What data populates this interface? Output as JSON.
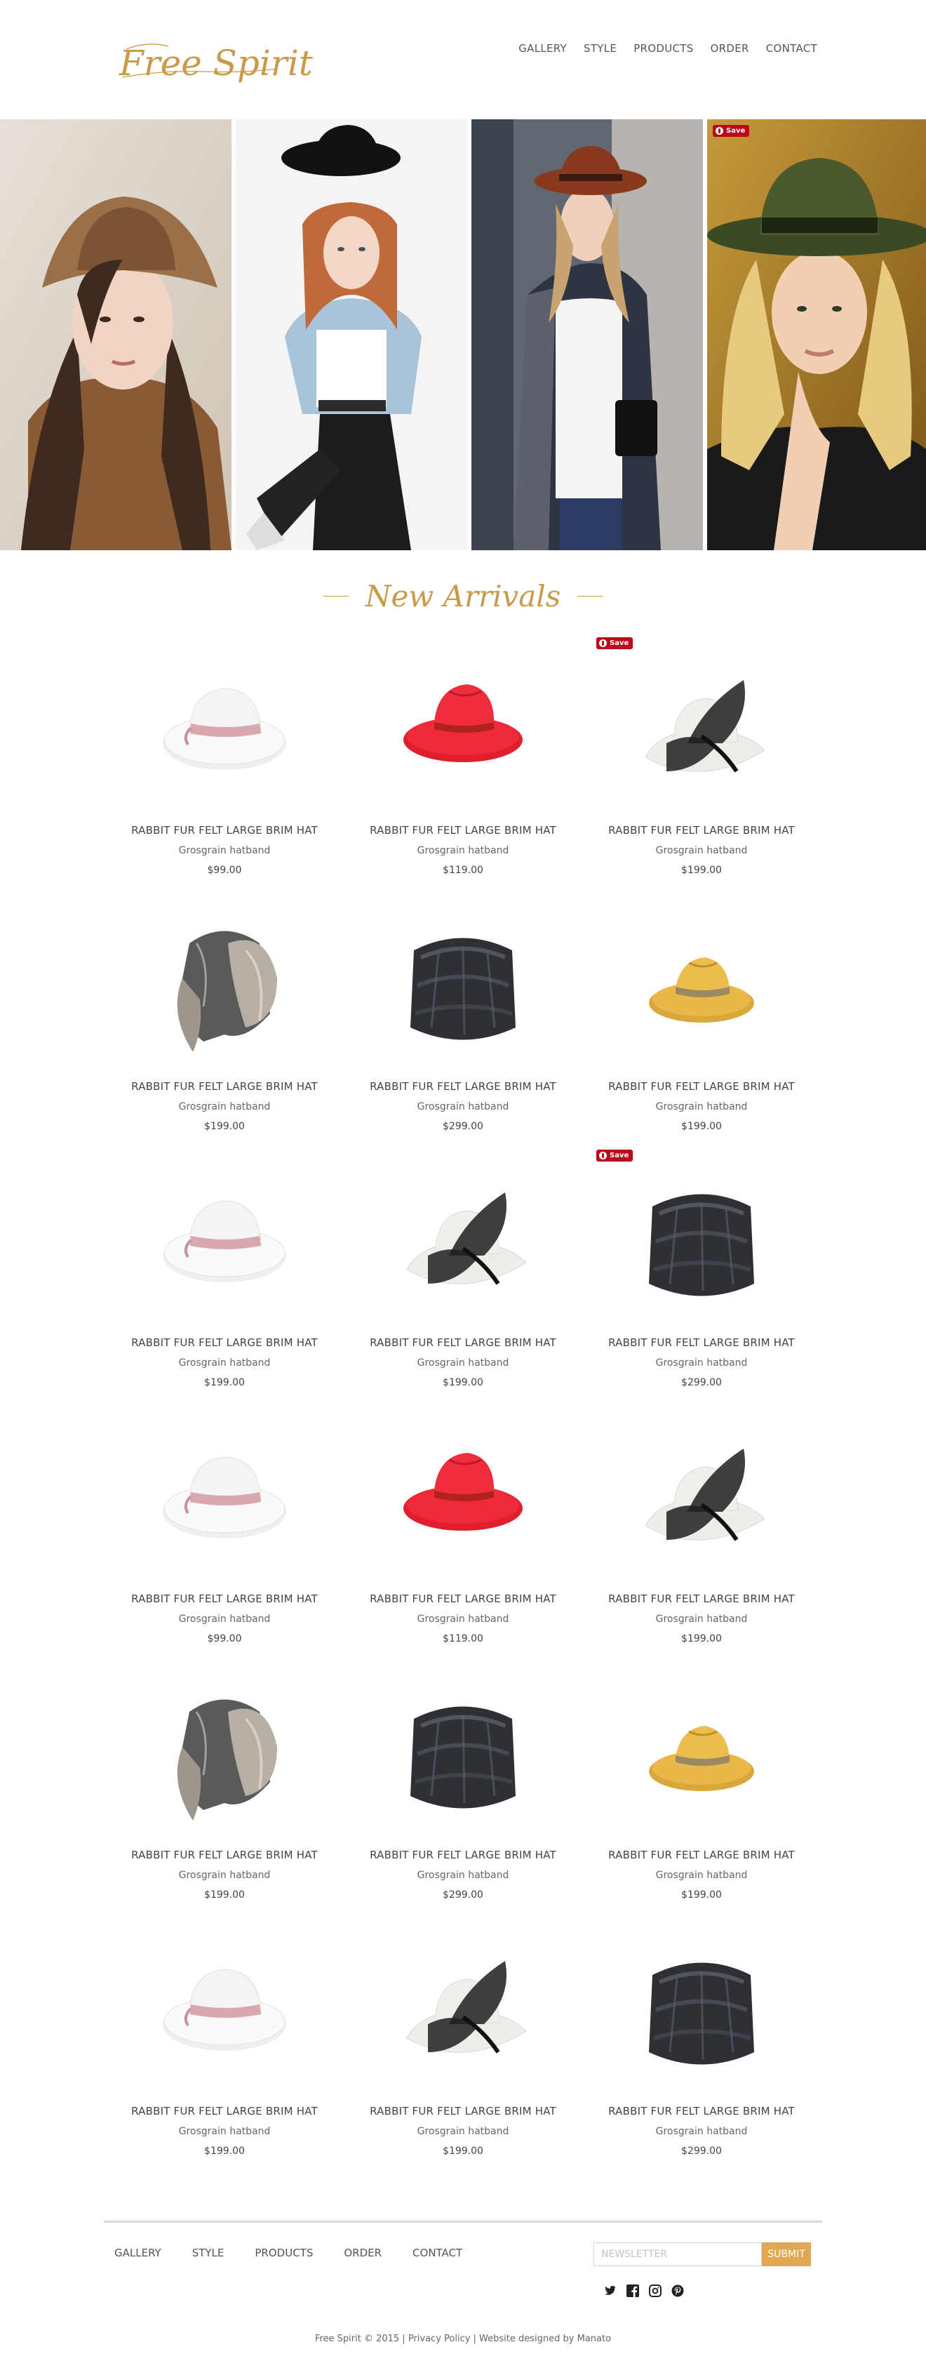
{
  "header": {
    "logo_text": "Free Spirit",
    "nav": [
      "GALLERY",
      "STYLE",
      "PRODUCTS",
      "ORDER",
      "CONTACT"
    ]
  },
  "hero": {
    "pin_save_label": "Save"
  },
  "section": {
    "title": "New Arrivals"
  },
  "products": [
    {
      "name": "RABBIT FUR FELT LARGE BRIM HAT",
      "sub": "Grosgrain hatband",
      "price": "$99.00",
      "img": "white-pink-hat",
      "pin": false
    },
    {
      "name": "RABBIT FUR FELT LARGE BRIM HAT",
      "sub": "Grosgrain hatband",
      "price": "$119.00",
      "img": "red-fedora",
      "pin": false
    },
    {
      "name": "RABBIT FUR FELT LARGE BRIM HAT",
      "sub": "Grosgrain hatband",
      "price": "$199.00",
      "img": "white-bow-hat",
      "pin": true
    },
    {
      "name": "RABBIT FUR FELT LARGE BRIM HAT",
      "sub": "Grosgrain hatband",
      "price": "$199.00",
      "img": "fur-trapper-hat",
      "pin": false
    },
    {
      "name": "RABBIT FUR FELT LARGE BRIM HAT",
      "sub": "Grosgrain hatband",
      "price": "$299.00",
      "img": "black-fur-hat",
      "pin": false
    },
    {
      "name": "RABBIT FUR FELT LARGE BRIM HAT",
      "sub": "Grosgrain hatband",
      "price": "$199.00",
      "img": "yellow-fedora",
      "pin": false
    },
    {
      "name": "RABBIT FUR FELT LARGE BRIM HAT",
      "sub": "Grosgrain hatband",
      "price": "$199.00",
      "img": "white-pink-hat",
      "pin": false
    },
    {
      "name": "RABBIT FUR FELT LARGE BRIM HAT",
      "sub": "Grosgrain hatband",
      "price": "$199.00",
      "img": "white-bow-hat",
      "pin": false
    },
    {
      "name": "RABBIT FUR FELT LARGE BRIM HAT",
      "sub": "Grosgrain hatband",
      "price": "$299.00",
      "img": "black-fur-hat",
      "pin": true
    },
    {
      "name": "RABBIT FUR FELT LARGE BRIM HAT",
      "sub": "Grosgrain hatband",
      "price": "$99.00",
      "img": "white-pink-hat",
      "pin": false
    },
    {
      "name": "RABBIT FUR FELT LARGE BRIM HAT",
      "sub": "Grosgrain hatband",
      "price": "$119.00",
      "img": "red-fedora",
      "pin": false
    },
    {
      "name": "RABBIT FUR FELT LARGE BRIM HAT",
      "sub": "Grosgrain hatband",
      "price": "$199.00",
      "img": "white-bow-hat",
      "pin": false
    },
    {
      "name": "RABBIT FUR FELT LARGE BRIM HAT",
      "sub": "Grosgrain hatband",
      "price": "$199.00",
      "img": "fur-trapper-hat",
      "pin": false
    },
    {
      "name": "RABBIT FUR FELT LARGE BRIM HAT",
      "sub": "Grosgrain hatband",
      "price": "$299.00",
      "img": "black-fur-hat",
      "pin": false
    },
    {
      "name": "RABBIT FUR FELT LARGE BRIM HAT",
      "sub": "Grosgrain hatband",
      "price": "$199.00",
      "img": "yellow-fedora",
      "pin": false
    },
    {
      "name": "RABBIT FUR FELT LARGE BRIM HAT",
      "sub": "Grosgrain hatband",
      "price": "$199.00",
      "img": "white-pink-hat",
      "pin": false
    },
    {
      "name": "RABBIT FUR FELT LARGE BRIM HAT",
      "sub": "Grosgrain hatband",
      "price": "$199.00",
      "img": "white-bow-hat",
      "pin": false
    },
    {
      "name": "RABBIT FUR FELT LARGE BRIM HAT",
      "sub": "Grosgrain hatband",
      "price": "$299.00",
      "img": "black-fur-hat",
      "pin": false
    }
  ],
  "footer": {
    "nav": [
      "GALLERY",
      "STYLE",
      "PRODUCTS",
      "ORDER",
      "CONTACT"
    ],
    "newsletter_placeholder": "NEWSLETTER",
    "submit_label": "SUBMIT",
    "social_icons": [
      "twitter-icon",
      "facebook-icon",
      "instagram-icon",
      "pinterest-icon"
    ],
    "copyright": "Free Spirit © 2015 | Privacy Policy | Website designed by Manato"
  },
  "colors": {
    "accent": "#c99a4a",
    "submit": "#e0a850",
    "pinterest": "#bd081c"
  }
}
